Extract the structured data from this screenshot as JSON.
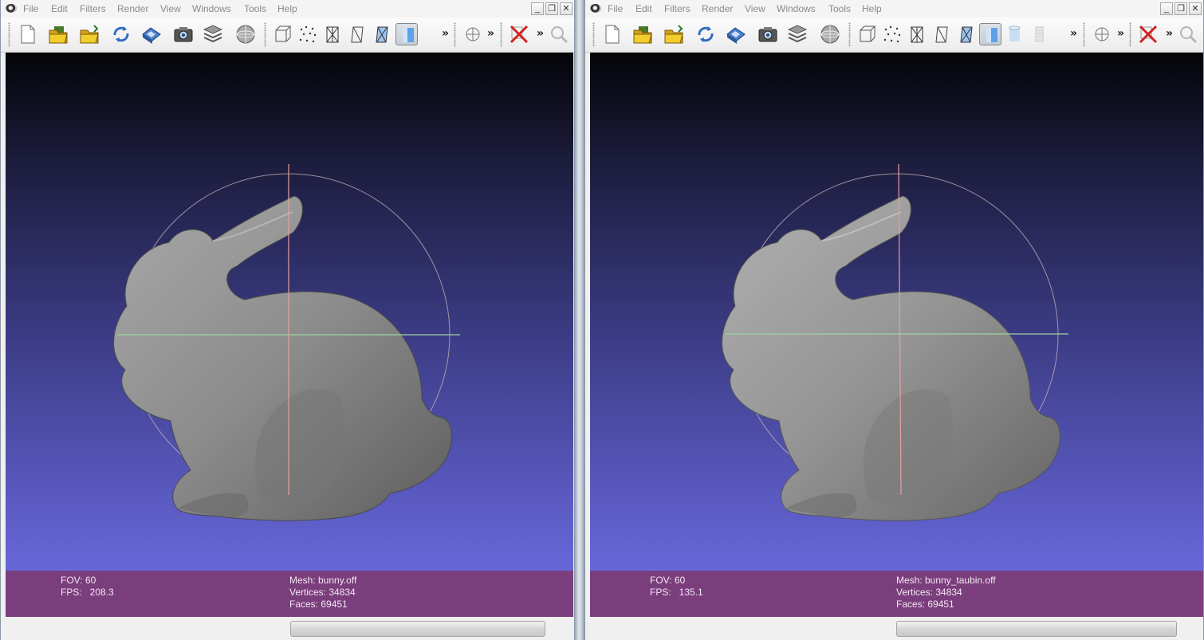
{
  "menu_items": [
    "File",
    "Edit",
    "Filters",
    "Render",
    "View",
    "Windows",
    "Tools",
    "Help"
  ],
  "window_buttons": {
    "minimize": "_",
    "restore": "❐",
    "close": "✕"
  },
  "toolbar": {
    "overflow_glyph": "»"
  },
  "colors": {
    "infobar": "#7b3e7d",
    "viewport_top": "#040408",
    "viewport_bottom": "#6767d9",
    "trackball_x_axis": "#9ed39e",
    "trackball_y_axis": "#e6a0a0",
    "mesh": "#8c8c8c"
  },
  "left": {
    "fov": "FOV: 60",
    "fps": "FPS:   208.3",
    "mesh": "Mesh: bunny.off",
    "vertices": "Vertices: 34834",
    "faces": "Faces: 69451"
  },
  "right": {
    "fov": "FOV: 60",
    "fps": "FPS:   135.1",
    "mesh": "Mesh: bunny_taubin.off",
    "vertices": "Vertices: 34834",
    "faces": "Faces: 69451"
  }
}
